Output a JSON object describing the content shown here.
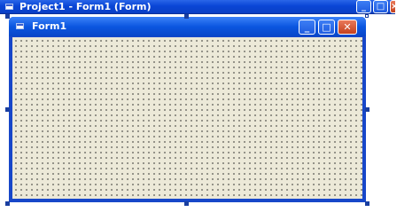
{
  "project_window": {
    "title": "Project1 - Form1 (Form)",
    "icon": "form-document-icon",
    "buttons": [
      {
        "name": "minimize",
        "glyph": "_"
      },
      {
        "name": "maximize",
        "glyph": "□"
      },
      {
        "name": "close",
        "glyph": "×"
      }
    ]
  },
  "form": {
    "title": "Form1",
    "icon": "form-document-icon",
    "buttons": [
      {
        "name": "minimize",
        "glyph": "_"
      },
      {
        "name": "maximize",
        "glyph": "□"
      },
      {
        "name": "close",
        "glyph": "✕"
      }
    ],
    "client_color": "#ece9d8",
    "titlebar_color": "#0b56e0"
  }
}
